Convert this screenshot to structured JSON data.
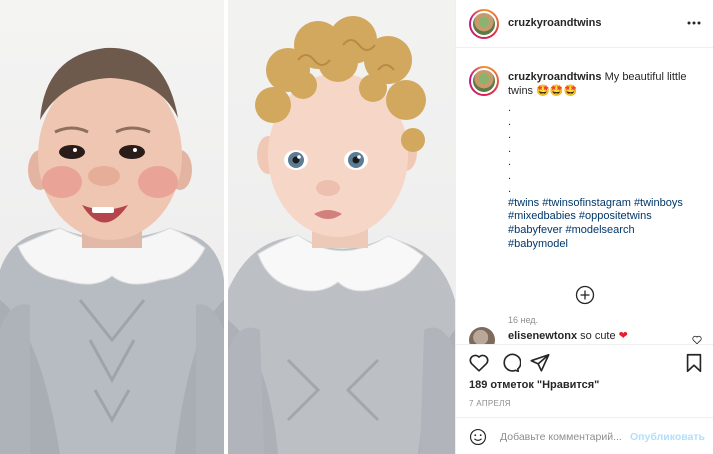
{
  "post": {
    "username": "cruzkyroandtwins",
    "caption": {
      "username": "cruzkyroandtwins",
      "text": "My beautiful little twins 🤩🤩🤩",
      "dots": [
        ".",
        ".",
        ".",
        ".",
        ".",
        ".",
        "."
      ],
      "hashtags": [
        "#twins #twinsofinstagram #twinboys",
        "#mixedbabies #oppositetwins",
        "#babyfever #modelsearch",
        "#babymodel"
      ]
    },
    "time_ago": "16 нед.",
    "comment": {
      "username": "elisenewtonx",
      "text": "so cute",
      "emoji": "❤"
    },
    "likes": "189 отметок \"Нравится\"",
    "date": "7 АПРЕЛЯ",
    "add_comment": {
      "placeholder": "Добавьте комментарий...",
      "publish_label": "Опубликовать"
    }
  },
  "icons": {
    "more": "more-horizontal-icon",
    "load_more": "plus-circle-icon",
    "like": "heart-icon",
    "comment": "speech-bubble-icon",
    "share": "paper-plane-icon",
    "save": "bookmark-icon",
    "emoji": "smiley-icon"
  },
  "colors": {
    "text": "#262626",
    "muted": "#8e8e8e",
    "hashtag": "#00376b",
    "publish_disabled": "#b2dffc",
    "heart": "#ed1b2e"
  }
}
